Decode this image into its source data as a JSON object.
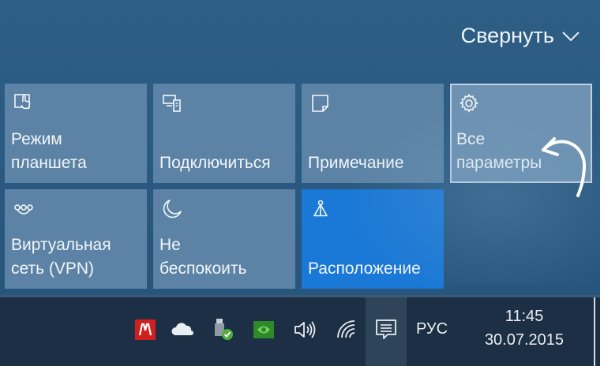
{
  "action_center": {
    "collapse_label": "Свернуть",
    "tiles": [
      {
        "label": "Режим\nпланшета",
        "icon": "tablet-mode-icon"
      },
      {
        "label": "Подключиться",
        "icon": "connect-icon"
      },
      {
        "label": "Примечание",
        "icon": "note-icon"
      },
      {
        "label": "Все\nпараметры",
        "icon": "gear-icon"
      },
      {
        "label": "Виртуальная\nсеть (VPN)",
        "icon": "vpn-icon"
      },
      {
        "label": "Не\nбеспокоить",
        "icon": "moon-icon"
      },
      {
        "label": "Расположение",
        "icon": "location-icon",
        "active": true
      }
    ]
  },
  "taskbar": {
    "tray_icons": [
      "adobe-icon",
      "onedrive-icon",
      "usb-device-icon",
      "nvidia-icon",
      "volume-icon",
      "wifi-icon",
      "notification-icon"
    ],
    "language": "РУС",
    "time": "11:45",
    "date": "30.07.2015"
  },
  "colors": {
    "panel_bg": "#2b5a82",
    "tile_bg": "#5c83a5",
    "tile_active": "#1a78d6",
    "taskbar_bg": "#1c2f44"
  }
}
